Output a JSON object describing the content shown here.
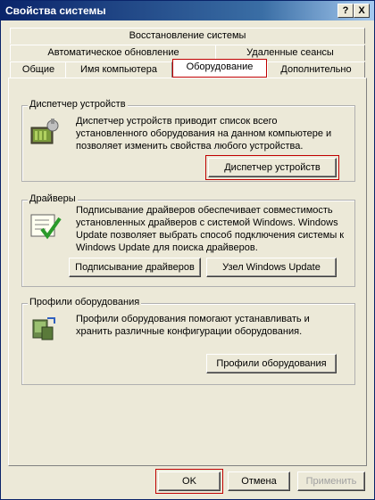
{
  "window": {
    "title": "Свойства системы",
    "help_label": "?",
    "close_label": "X"
  },
  "tabs": {
    "row1": [
      "Восстановление системы"
    ],
    "row2": [
      "Автоматическое обновление",
      "Удаленные сеансы"
    ],
    "row3": [
      "Общие",
      "Имя компьютера",
      "Оборудование",
      "Дополнительно"
    ],
    "active": "Оборудование"
  },
  "device_manager": {
    "title": "Диспетчер устройств",
    "description": "Диспетчер устройств приводит список всего установленного оборудования на данном компьютере и позволяет изменить свойства любого устройства.",
    "button": "Диспетчер устройств"
  },
  "drivers": {
    "title": "Драйверы",
    "description": "Подписывание драйверов обеспечивает совместимость установленных драйверов с системой Windows. Windows Update позволяет выбрать способ подключения системы к Windows Update для поиска драйверов.",
    "button_signing": "Подписывание драйверов",
    "button_update": "Узел Windows Update"
  },
  "profiles": {
    "title": "Профили оборудования",
    "description": "Профили оборудования помогают устанавливать и хранить различные конфигурации оборудования.",
    "button": "Профили оборудования"
  },
  "footer": {
    "ok": "OK",
    "cancel": "Отмена",
    "apply": "Применить"
  }
}
